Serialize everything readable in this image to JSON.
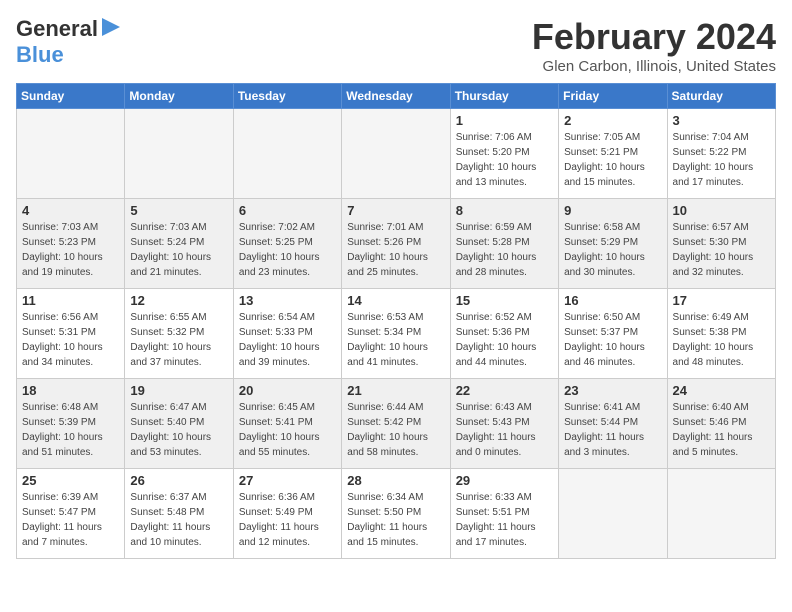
{
  "header": {
    "logo_general": "General",
    "logo_blue": "Blue",
    "month_title": "February 2024",
    "location": "Glen Carbon, Illinois, United States"
  },
  "calendar": {
    "weekdays": [
      "Sunday",
      "Monday",
      "Tuesday",
      "Wednesday",
      "Thursday",
      "Friday",
      "Saturday"
    ],
    "weeks": [
      [
        {
          "day": "",
          "empty": true
        },
        {
          "day": "",
          "empty": true
        },
        {
          "day": "",
          "empty": true
        },
        {
          "day": "",
          "empty": true
        },
        {
          "day": "1",
          "info": "Sunrise: 7:06 AM\nSunset: 5:20 PM\nDaylight: 10 hours\nand 13 minutes."
        },
        {
          "day": "2",
          "info": "Sunrise: 7:05 AM\nSunset: 5:21 PM\nDaylight: 10 hours\nand 15 minutes."
        },
        {
          "day": "3",
          "info": "Sunrise: 7:04 AM\nSunset: 5:22 PM\nDaylight: 10 hours\nand 17 minutes."
        }
      ],
      [
        {
          "day": "4",
          "info": "Sunrise: 7:03 AM\nSunset: 5:23 PM\nDaylight: 10 hours\nand 19 minutes.",
          "shaded": true
        },
        {
          "day": "5",
          "info": "Sunrise: 7:03 AM\nSunset: 5:24 PM\nDaylight: 10 hours\nand 21 minutes.",
          "shaded": true
        },
        {
          "day": "6",
          "info": "Sunrise: 7:02 AM\nSunset: 5:25 PM\nDaylight: 10 hours\nand 23 minutes.",
          "shaded": true
        },
        {
          "day": "7",
          "info": "Sunrise: 7:01 AM\nSunset: 5:26 PM\nDaylight: 10 hours\nand 25 minutes.",
          "shaded": true
        },
        {
          "day": "8",
          "info": "Sunrise: 6:59 AM\nSunset: 5:28 PM\nDaylight: 10 hours\nand 28 minutes.",
          "shaded": true
        },
        {
          "day": "9",
          "info": "Sunrise: 6:58 AM\nSunset: 5:29 PM\nDaylight: 10 hours\nand 30 minutes.",
          "shaded": true
        },
        {
          "day": "10",
          "info": "Sunrise: 6:57 AM\nSunset: 5:30 PM\nDaylight: 10 hours\nand 32 minutes.",
          "shaded": true
        }
      ],
      [
        {
          "day": "11",
          "info": "Sunrise: 6:56 AM\nSunset: 5:31 PM\nDaylight: 10 hours\nand 34 minutes."
        },
        {
          "day": "12",
          "info": "Sunrise: 6:55 AM\nSunset: 5:32 PM\nDaylight: 10 hours\nand 37 minutes."
        },
        {
          "day": "13",
          "info": "Sunrise: 6:54 AM\nSunset: 5:33 PM\nDaylight: 10 hours\nand 39 minutes."
        },
        {
          "day": "14",
          "info": "Sunrise: 6:53 AM\nSunset: 5:34 PM\nDaylight: 10 hours\nand 41 minutes."
        },
        {
          "day": "15",
          "info": "Sunrise: 6:52 AM\nSunset: 5:36 PM\nDaylight: 10 hours\nand 44 minutes."
        },
        {
          "day": "16",
          "info": "Sunrise: 6:50 AM\nSunset: 5:37 PM\nDaylight: 10 hours\nand 46 minutes."
        },
        {
          "day": "17",
          "info": "Sunrise: 6:49 AM\nSunset: 5:38 PM\nDaylight: 10 hours\nand 48 minutes."
        }
      ],
      [
        {
          "day": "18",
          "info": "Sunrise: 6:48 AM\nSunset: 5:39 PM\nDaylight: 10 hours\nand 51 minutes.",
          "shaded": true
        },
        {
          "day": "19",
          "info": "Sunrise: 6:47 AM\nSunset: 5:40 PM\nDaylight: 10 hours\nand 53 minutes.",
          "shaded": true
        },
        {
          "day": "20",
          "info": "Sunrise: 6:45 AM\nSunset: 5:41 PM\nDaylight: 10 hours\nand 55 minutes.",
          "shaded": true
        },
        {
          "day": "21",
          "info": "Sunrise: 6:44 AM\nSunset: 5:42 PM\nDaylight: 10 hours\nand 58 minutes.",
          "shaded": true
        },
        {
          "day": "22",
          "info": "Sunrise: 6:43 AM\nSunset: 5:43 PM\nDaylight: 11 hours\nand 0 minutes.",
          "shaded": true
        },
        {
          "day": "23",
          "info": "Sunrise: 6:41 AM\nSunset: 5:44 PM\nDaylight: 11 hours\nand 3 minutes.",
          "shaded": true
        },
        {
          "day": "24",
          "info": "Sunrise: 6:40 AM\nSunset: 5:46 PM\nDaylight: 11 hours\nand 5 minutes.",
          "shaded": true
        }
      ],
      [
        {
          "day": "25",
          "info": "Sunrise: 6:39 AM\nSunset: 5:47 PM\nDaylight: 11 hours\nand 7 minutes."
        },
        {
          "day": "26",
          "info": "Sunrise: 6:37 AM\nSunset: 5:48 PM\nDaylight: 11 hours\nand 10 minutes."
        },
        {
          "day": "27",
          "info": "Sunrise: 6:36 AM\nSunset: 5:49 PM\nDaylight: 11 hours\nand 12 minutes."
        },
        {
          "day": "28",
          "info": "Sunrise: 6:34 AM\nSunset: 5:50 PM\nDaylight: 11 hours\nand 15 minutes."
        },
        {
          "day": "29",
          "info": "Sunrise: 6:33 AM\nSunset: 5:51 PM\nDaylight: 11 hours\nand 17 minutes."
        },
        {
          "day": "",
          "empty": true
        },
        {
          "day": "",
          "empty": true
        }
      ]
    ]
  }
}
